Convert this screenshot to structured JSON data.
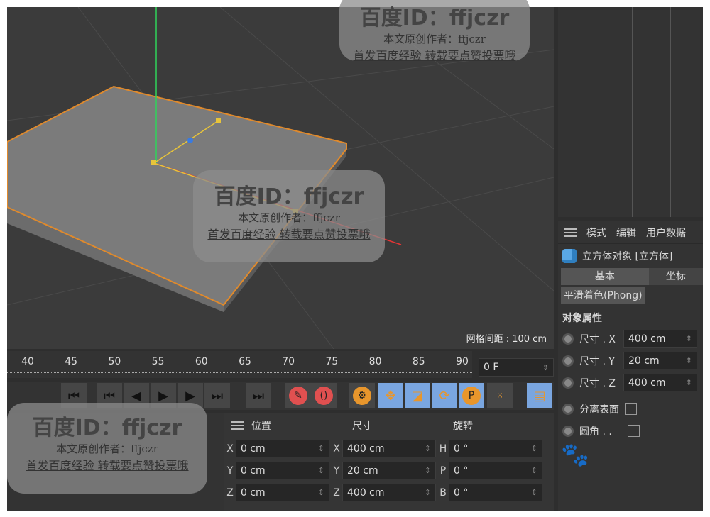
{
  "viewport": {
    "grid_spacing_label": "网格间距 : 100 cm"
  },
  "timeline": {
    "ticks": [
      "40",
      "45",
      "50",
      "55",
      "60",
      "65",
      "70",
      "75",
      "80",
      "85",
      "90"
    ],
    "current_frame": "0 F"
  },
  "toolbar": {
    "buttons": [
      "go-to-start",
      "prev-key",
      "prev-frame",
      "play",
      "next-frame",
      "next-key",
      "go-to-end",
      "record",
      "autokey",
      "keyframe-settings",
      "move",
      "scale",
      "rotate",
      "param",
      "pla",
      "timeline"
    ]
  },
  "attributes": {
    "menu": [
      "模式",
      "编辑",
      "用户数据"
    ],
    "object_title": "立方体对象 [立方体]",
    "tabs": [
      "基本",
      "坐标"
    ],
    "phong_tab": "平滑着色(Phong)",
    "section": "对象属性",
    "size_rows": [
      {
        "label": "尺寸 . X",
        "value": "400 cm"
      },
      {
        "label": "尺寸 . Y",
        "value": "20 cm"
      },
      {
        "label": "尺寸 . Z",
        "value": "400 cm"
      }
    ],
    "check_rows": [
      {
        "label": "分离表面"
      },
      {
        "label": "圆角 . ."
      }
    ]
  },
  "coordinates": {
    "headers": [
      "位置",
      "尺寸",
      "旋转"
    ],
    "rows": [
      {
        "pl": "X",
        "p": "0 cm",
        "sl": "X",
        "s": "400 cm",
        "rl": "H",
        "r": "0 °"
      },
      {
        "pl": "Y",
        "p": "0 cm",
        "sl": "Y",
        "s": "20 cm",
        "rl": "P",
        "r": "0 °"
      },
      {
        "pl": "Z",
        "p": "0 cm",
        "sl": "Z",
        "s": "400 cm",
        "rl": "B",
        "r": "0 °"
      }
    ]
  },
  "watermark": {
    "id": "百度ID：ffjczr",
    "line2": "本文原创作者：ffjczr",
    "line3": "首发百度经验 转载要点赞投票哦",
    "logo": "Baidu"
  }
}
